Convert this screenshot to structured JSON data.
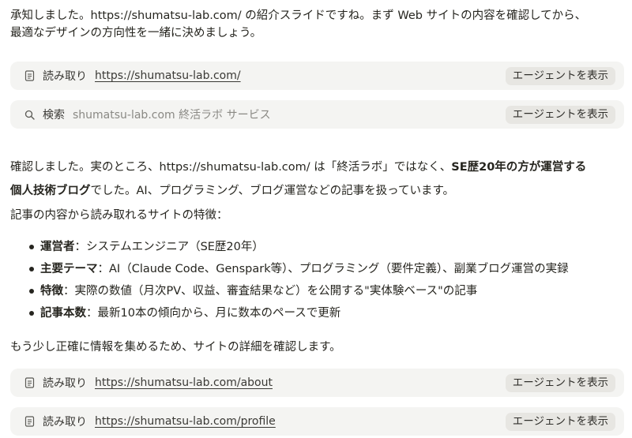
{
  "intro": {
    "line1": "承知しました。https://shumatsu-lab.com/ の紹介スライドですね。まず Web サイトの内容を確認してから、",
    "line2": "最適なデザインの方向性を一緒に決めましょう。"
  },
  "tool_calls": [
    {
      "kind": "読み取り",
      "url": "https://shumatsu-lab.com/",
      "button": "エージェントを表示",
      "icon": "document-icon"
    },
    {
      "kind": "検索",
      "query": "shumatsu-lab.com 終活ラボ サービス",
      "button": "エージェントを表示",
      "icon": "search-icon"
    },
    {
      "kind": "読み取り",
      "url": "https://shumatsu-lab.com/about",
      "button": "エージェントを表示",
      "icon": "document-icon"
    },
    {
      "kind": "読み取り",
      "url": "https://shumatsu-lab.com/profile",
      "button": "エージェントを表示",
      "icon": "document-icon"
    }
  ],
  "confirm": {
    "prefix": "確認しました。実のところ、https://shumatsu-lab.com/ は「終活ラボ」ではなく、",
    "bold1": "SE歴20年の方が運営する",
    "bold2": "個人技術ブログ",
    "suffix": "でした。AI、プログラミング、ブログ運営などの記事を扱っています。"
  },
  "features_intro": "記事の内容から読み取れるサイトの特徴：",
  "features": [
    {
      "label": "運営者",
      "text": "：システムエンジニア（SE歴20年）"
    },
    {
      "label": "主要テーマ",
      "text": "：AI（Claude Code、Genspark等）、プログラミング（要件定義）、副業ブログ運営の実録"
    },
    {
      "label": "特徴",
      "text": "：実際の数値（月次PV、収益、審査結果など）を公開する\"実体験ベース\"の記事"
    },
    {
      "label": "記事本数",
      "text": "：最新10本の傾向から、月に数本のペースで更新"
    }
  ],
  "closing": "もう少し正確に情報を集めるため、サイトの詳細を確認します。"
}
